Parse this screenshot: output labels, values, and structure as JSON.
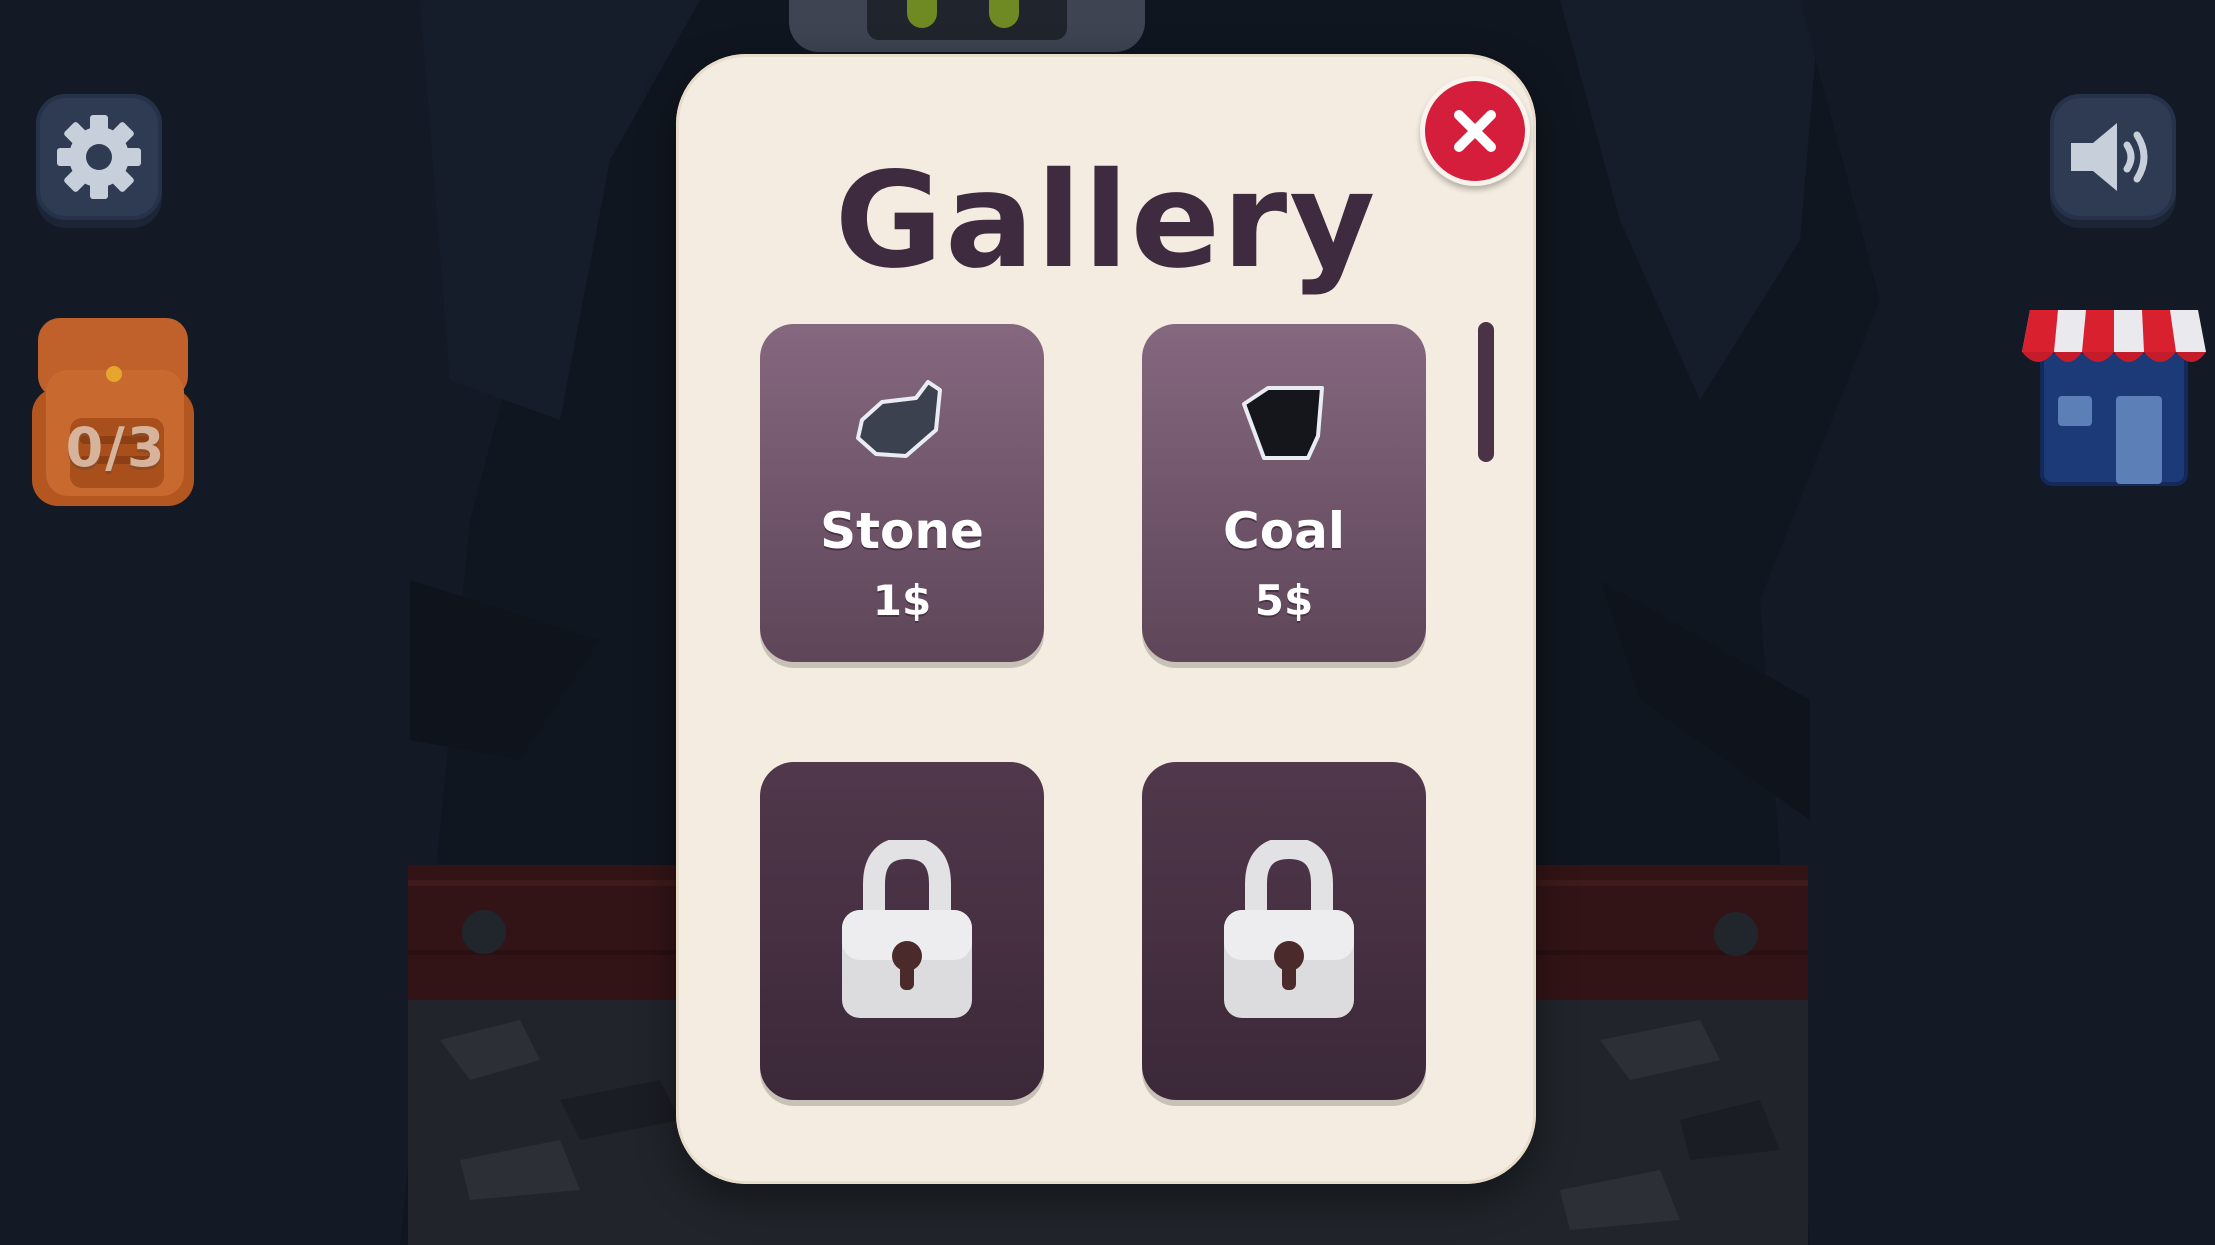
{
  "hud": {
    "settings_icon": "gear-icon",
    "sound_icon": "speaker-icon",
    "backpack_count": "0/3",
    "shop_icon": "shop-icon"
  },
  "gallery": {
    "title": "Gallery",
    "close_icon": "close-icon",
    "items": [
      {
        "name": "Stone",
        "price": "1$",
        "locked": false,
        "icon": "stone-icon"
      },
      {
        "name": "Coal",
        "price": "5$",
        "locked": false,
        "icon": "coal-icon"
      },
      {
        "locked": true,
        "icon": "lock-icon"
      },
      {
        "locked": true,
        "icon": "lock-icon"
      }
    ]
  },
  "colors": {
    "modal_bg": "#f4ece0",
    "title": "#3f2b3f",
    "close_button": "#d51e3c",
    "card_unlocked": "#7a5f74",
    "card_locked": "#46313f"
  }
}
